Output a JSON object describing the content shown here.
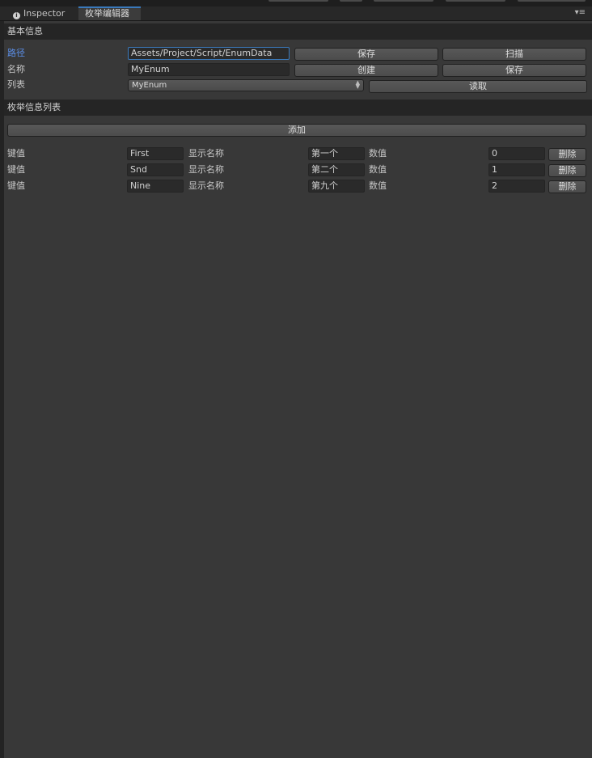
{
  "tabs": [
    {
      "label": "Inspector",
      "icon": "info-icon",
      "active": false
    },
    {
      "label": "枚举编辑器",
      "active": true
    }
  ],
  "basic": {
    "header": "基本信息",
    "path_label": "路径",
    "path_value": "Assets/Project/Script/EnumData",
    "name_label": "名称",
    "name_value": "MyEnum",
    "list_label": "列表",
    "list_selected": "MyEnum",
    "buttons": {
      "save_path": "保存",
      "scan": "扫描",
      "create": "创建",
      "save_name": "保存",
      "read": "读取"
    }
  },
  "enum_list": {
    "header": "枚举信息列表",
    "add_button": "添加",
    "key_label": "键值",
    "display_label": "显示名称",
    "value_label": "数值",
    "delete_label": "删除",
    "rows": [
      {
        "key": "First",
        "display": "第一个",
        "value": "0"
      },
      {
        "key": "Snd",
        "display": "第二个",
        "value": "1"
      },
      {
        "key": "Nine",
        "display": "第九个",
        "value": "2"
      }
    ]
  },
  "colors": {
    "panel_bg": "#383838",
    "section_bg": "#252525",
    "accent": "#3a79bb",
    "label_highlight": "#5b8ee6"
  }
}
